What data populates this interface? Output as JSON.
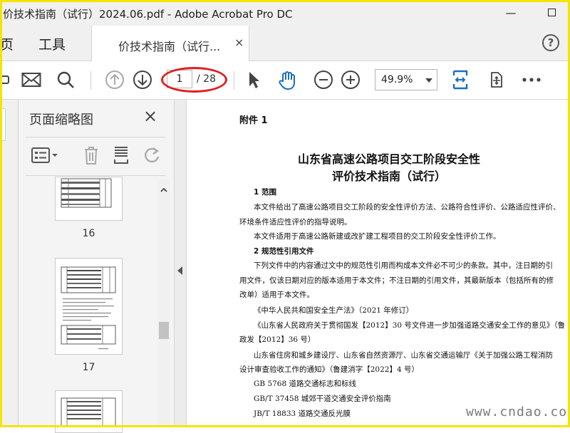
{
  "window": {
    "title": "价技术指南（试行）2024.06.pdf - Adobe Acrobat Pro DC"
  },
  "tabs": {
    "home": "页",
    "tools": "工具",
    "doc_tab_label": "价技术指南（试行...",
    "close": "×",
    "help": "?"
  },
  "toolbar": {
    "page_current": "1",
    "page_total": "/ 28",
    "zoom": "49.9%"
  },
  "panel": {
    "title": "页面缩略图",
    "close": "×",
    "thumbs": [
      {
        "num": "16"
      },
      {
        "num": "17"
      }
    ]
  },
  "document": {
    "annex": "附件 1",
    "title_line1": "山东省高速公路项目交工阶段安全性",
    "title_line2": "评价技术指南（试行）",
    "lines": [
      "1  范围",
      "本文件给出了高速公路项目交工阶段的安全性评价方法、公路符合性评价、公路适应性评价、",
      "环境条件适应性评价的指导说明。",
      "本文件适用于高速公路新建或改扩建工程项目的交工阶段安全性评价工作。",
      "2  规范性引用文件",
      "下列文件中的内容通过文中的规范性引用而构成本文件必不可少的条款。其中，注日期的引",
      "用文件，仅该日期对应的版本适用于本文件；不注日期的引用文件，其最新版本（包括所有的修",
      "改单）适用于本文件。",
      "《中华人民共和国安全生产法》（2021 年修订）",
      "《山东省人民政府关于贯彻国发【2012】30 号文件进一步加强道路交通安全工作的意见》（鲁",
      "政发【2012】36 号）",
      "山东省住房和城乡建设厅、山东省自然资源厅、山东省交通运输厅《关于加强公路工程消防",
      "设计审查验收工作的通知》（鲁建消字【2022】4 号）",
      "GB 5768  道路交通标志和标线",
      "GB/T 37458  城郊干道交通安全评价指南",
      "JB/T 18833 道路交通反光膜"
    ]
  },
  "watermark": "www.cndao.com"
}
